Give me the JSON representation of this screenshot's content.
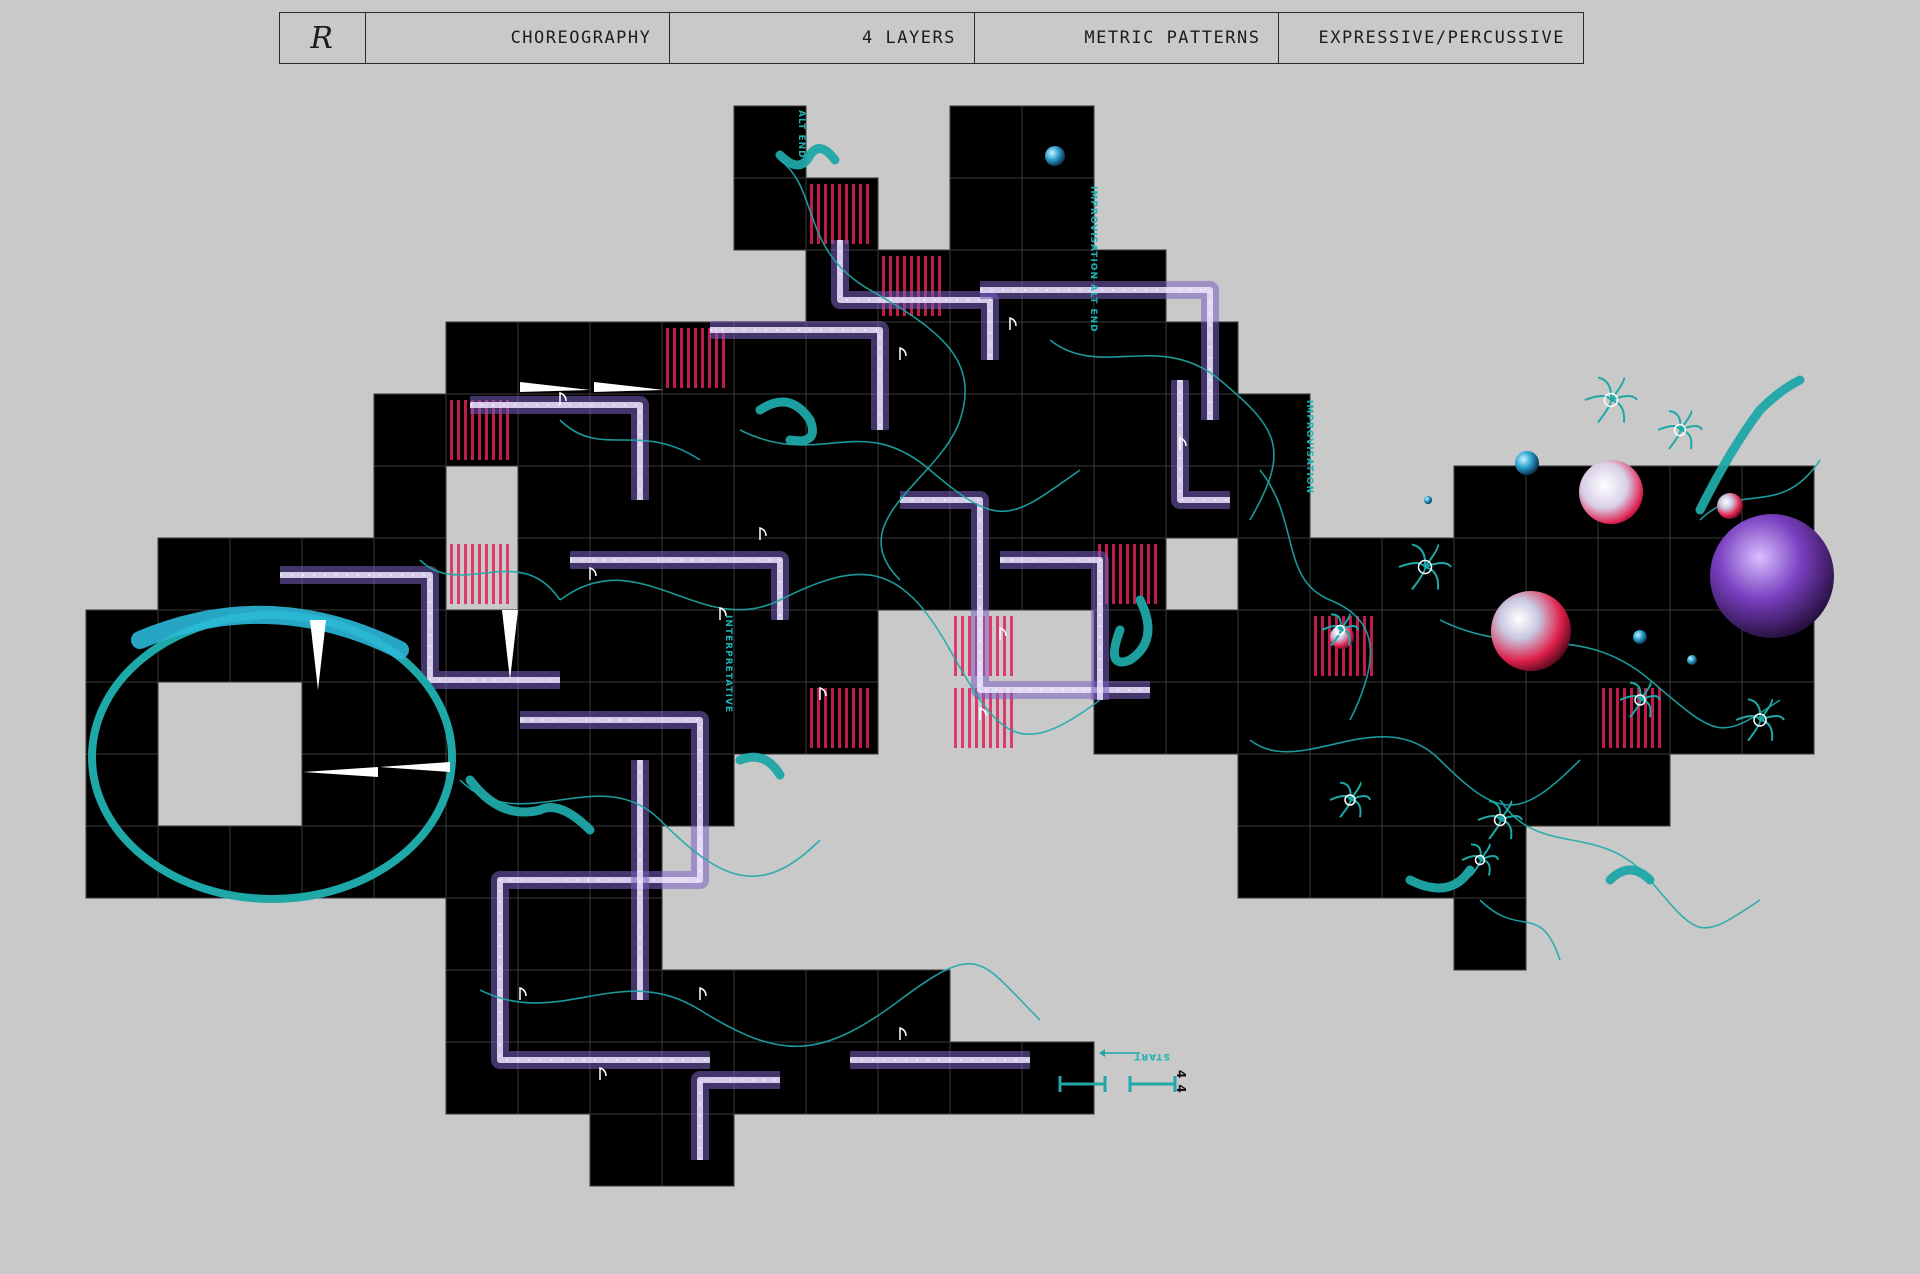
{
  "header": {
    "logo": "R",
    "cells": [
      "CHOREOGRAPHY",
      "4 LAYERS",
      "METRIC PATTERNS",
      "EXPRESSIVE/PERCUSSIVE"
    ]
  },
  "score": {
    "labels": {
      "alt_end_top": "ALT END",
      "improvisation_top": "IMPROVISATION",
      "alt_end_mid": "ALT END",
      "improvisation_right": "IMPROVISATION",
      "interpretative": "INTERPRETATIVE",
      "start": "START",
      "time_signature": "4 4"
    }
  },
  "colors": {
    "background": "#c9c9c9",
    "tile": "#000000",
    "grid_line": "#3a3a3a",
    "flow": "#1fa8a8",
    "path_light": "#ece6ff",
    "path_dark": "#7a5fc0",
    "accent": "#e0205a",
    "sphere_blue": "#2aa3d8"
  }
}
